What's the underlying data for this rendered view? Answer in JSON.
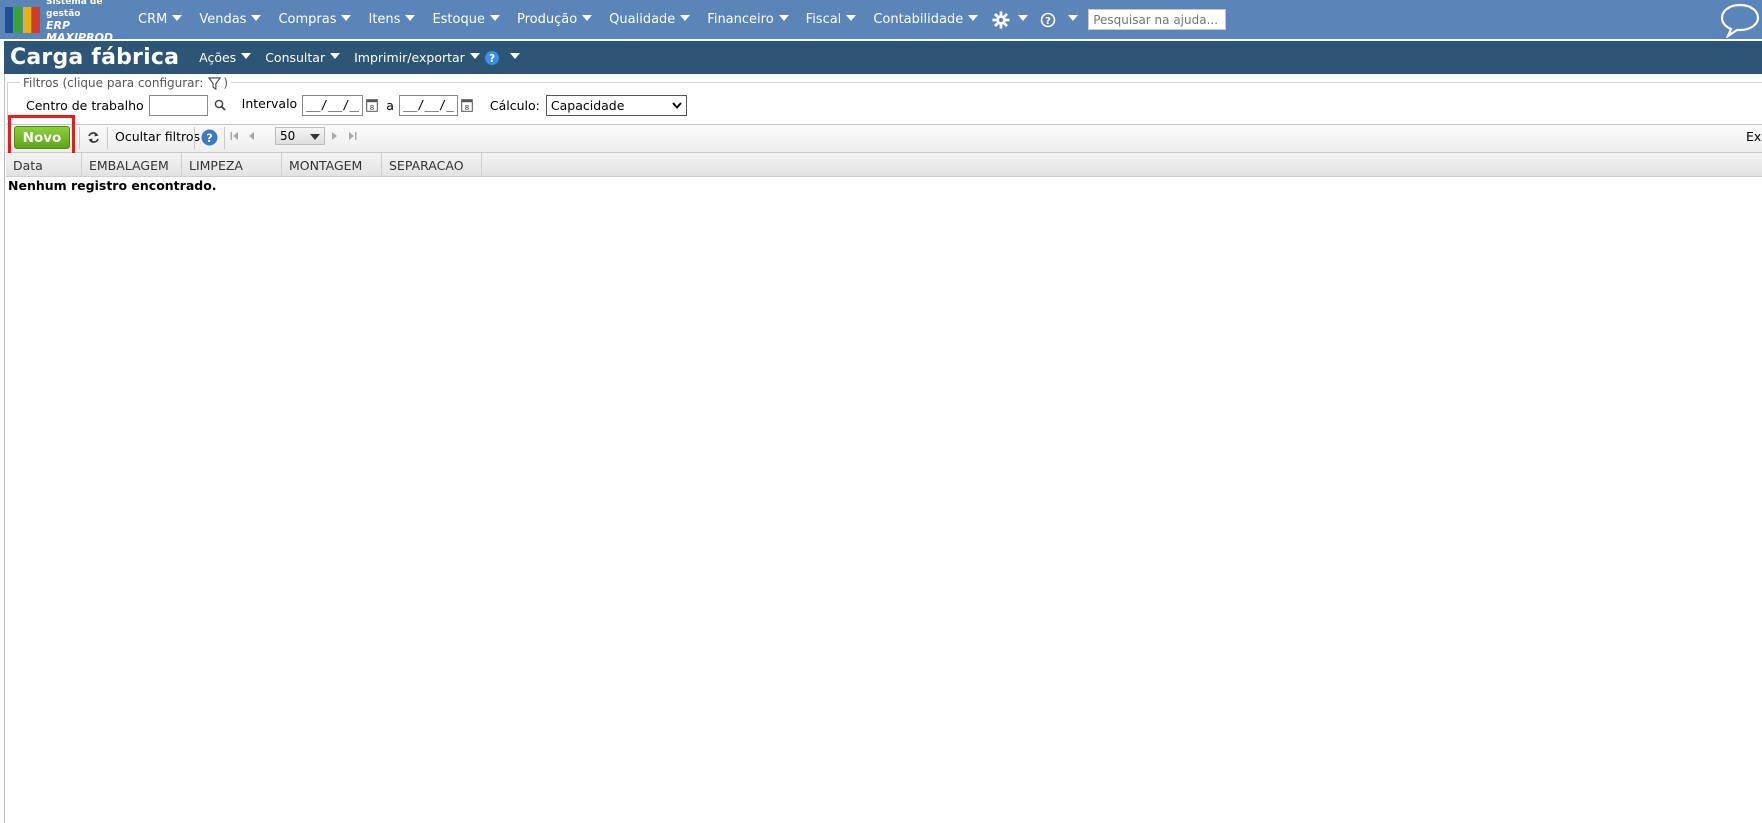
{
  "app": {
    "logo_small": "Sistema de gestão",
    "logo_big": "ERP MAXIPROD",
    "logo_colors": [
      "#1f4e9b",
      "#3aa335",
      "#e5b21a",
      "#d23b2b"
    ]
  },
  "nav": {
    "items": [
      {
        "label": "CRM"
      },
      {
        "label": "Vendas"
      },
      {
        "label": "Compras"
      },
      {
        "label": "Itens"
      },
      {
        "label": "Estoque"
      },
      {
        "label": "Produção"
      },
      {
        "label": "Qualidade"
      },
      {
        "label": "Financeiro"
      },
      {
        "label": "Fiscal"
      },
      {
        "label": "Contabilidade"
      }
    ],
    "search_placeholder": "Pesquisar na ajuda...",
    "bar_color": "#5b84b9"
  },
  "page": {
    "title": "Carga fábrica",
    "menus": {
      "acoes": "Ações",
      "consultar": "Consultar",
      "imprimir": "Imprimir/exportar"
    },
    "title_bar_color": "#2d5576"
  },
  "filters": {
    "legend": "Filtros (clique para configurar:",
    "legend_close": ")",
    "centro_label": "Centro de trabalho",
    "centro_value": "",
    "intervalo_label": "Intervalo",
    "date_from": "__/__/__",
    "date_sep": "a",
    "date_to": "__/__/__",
    "calculo_label": "Cálculo:",
    "calculo_value": "Capacidade"
  },
  "toolbar": {
    "novo_label": "Novo",
    "ocultar_label": "Ocultar filtros",
    "page_size": "50",
    "right_truncated": "Exi",
    "novo_color": "#6fb926",
    "highlight_color": "#e02020"
  },
  "grid": {
    "columns": [
      "Data",
      "EMBALAGEM",
      "LIMPEZA",
      "MONTAGEM",
      "SEPARACAO"
    ],
    "empty_message": "Nenhum registro encontrado."
  }
}
